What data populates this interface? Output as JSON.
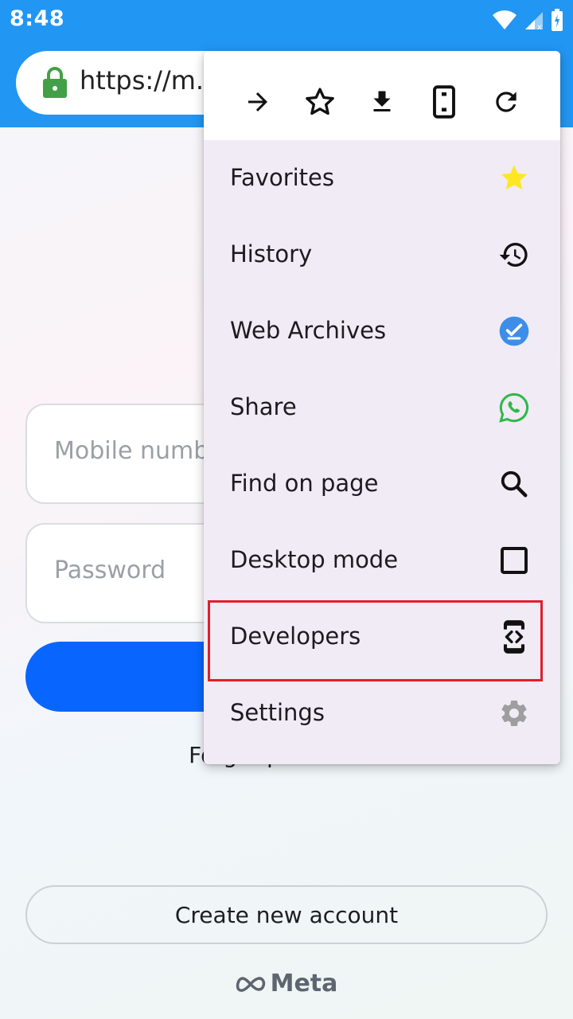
{
  "status_bar": {
    "time": "8:48"
  },
  "address_bar": {
    "url": "https://m.facebook.com"
  },
  "login": {
    "mobile_placeholder": "Mobile number or email",
    "password_placeholder": "Password",
    "forgot_text": "Forgot password?",
    "create_account": "Create new account",
    "meta_logo": "Meta"
  },
  "menu": {
    "toolbar": [
      "forward-icon",
      "bookmark-star-icon",
      "download-icon",
      "phone-icon",
      "refresh-icon"
    ],
    "items": [
      {
        "label": "Favorites",
        "icon": "star-icon"
      },
      {
        "label": "History",
        "icon": "history-icon"
      },
      {
        "label": "Web Archives",
        "icon": "archive-check-icon"
      },
      {
        "label": "Share",
        "icon": "whatsapp-icon"
      },
      {
        "label": "Find on page",
        "icon": "search-icon"
      },
      {
        "label": "Desktop mode",
        "icon": "checkbox-icon"
      },
      {
        "label": "Developers",
        "icon": "developer-mode-icon"
      },
      {
        "label": "Settings",
        "icon": "gear-icon"
      }
    ]
  },
  "colors": {
    "app_bar": "#2196f3",
    "login_button": "#0866ff",
    "highlight": "#e0202a",
    "menu_background": "#f1ebf5"
  }
}
